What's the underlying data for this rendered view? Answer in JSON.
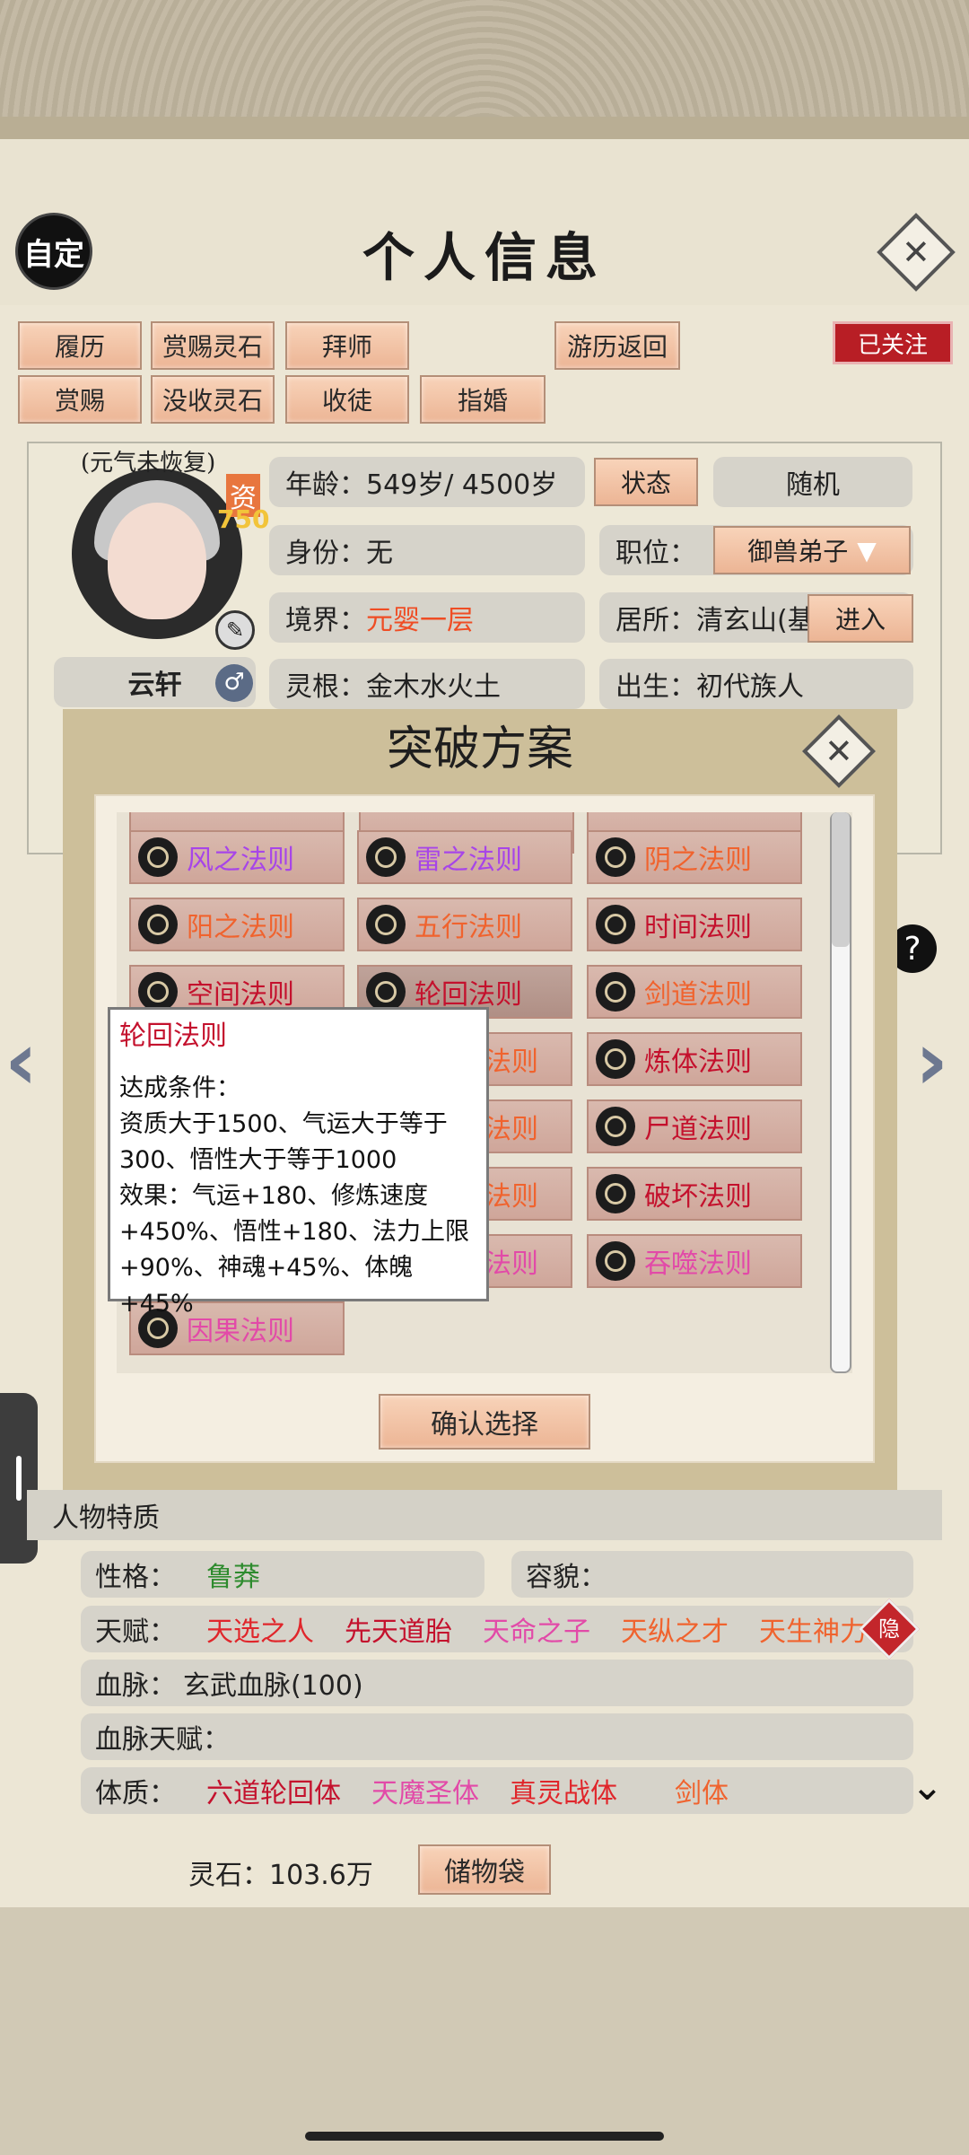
{
  "header": {
    "title": "个人信息",
    "custom_label": "自定",
    "follow_label": "已关注"
  },
  "actions": {
    "row1": [
      "履历",
      "赏赐灵石",
      "拜师"
    ],
    "row2": [
      "赏赐",
      "没收灵石",
      "收徒",
      "指婚"
    ],
    "return_label": "游历返回"
  },
  "profile": {
    "status_note": "(元气未恢复)",
    "aptitude_label": "资",
    "aptitude_value": "750",
    "name": "云轩",
    "age_label": "年龄：",
    "age_value": "549岁/ 4500岁",
    "state_btn": "状态",
    "random_btn": "随机",
    "identity_label": "身份：",
    "identity_value": "无",
    "position_label": "职位：",
    "position_value": "御兽弟子",
    "realm_label": "境界：",
    "realm_value": "元婴一层",
    "residence_label": "居所：",
    "residence_value": "清玄山(基",
    "enter_btn": "进入",
    "root_label": "灵根：",
    "root_value": "金木水火土",
    "birth_label": "出生：",
    "birth_value": "初代族人"
  },
  "dialog": {
    "title": "突破方案",
    "confirm_label": "确认选择",
    "laws": [
      {
        "name": "风之法则",
        "color": "#a745e8"
      },
      {
        "name": "雷之法则",
        "color": "#a745e8"
      },
      {
        "name": "阴之法则",
        "color": "#f0632e"
      },
      {
        "name": "阳之法则",
        "color": "#f0632e"
      },
      {
        "name": "五行法则",
        "color": "#f0632e"
      },
      {
        "name": "时间法则",
        "color": "#c4112d"
      },
      {
        "name": "空间法则",
        "color": "#c4112d"
      },
      {
        "name": "轮回法则",
        "color": "#c4112d"
      },
      {
        "name": "剑道法则",
        "color": "#f0632e"
      },
      {
        "name": "炼体法则",
        "color": "#c4112d"
      },
      {
        "name": "尸道法则",
        "color": "#c4112d"
      },
      {
        "name": "破坏法则",
        "color": "#c4112d"
      },
      {
        "name": "吞噬法则",
        "color": "#e24aa8"
      },
      {
        "name": "因果法则",
        "color": "#e24aa8"
      }
    ],
    "hidden_partial": [
      "法则",
      "法则",
      "法则",
      "法则"
    ]
  },
  "tooltip": {
    "title": "轮回法则",
    "condition_label": "达成条件：",
    "lines": [
      "资质大于1500、气运大于等于",
      "300、悟性大于等于1000",
      "效果：气运+180、修炼速度",
      "+450%、悟性+180、法力上限",
      "+90%、神魂+45%、体魄+45%"
    ]
  },
  "traits": {
    "header": "人物特质",
    "personality_label": "性格：",
    "personality_value": "鲁莽",
    "appearance_label": "容貌：",
    "talent_label": "天赋：",
    "talents": [
      {
        "name": "天选之人",
        "color": "#e0262b"
      },
      {
        "name": "先天道胎",
        "color": "#c4112d"
      },
      {
        "name": "天命之子",
        "color": "#e24aa8"
      },
      {
        "name": "天纵之才",
        "color": "#f0632e"
      },
      {
        "name": "天生神力",
        "color": "#f0632e"
      }
    ],
    "hide_label": "隐",
    "bloodline_label": "血脉：",
    "bloodline_value": "玄武血脉(100)",
    "bloodline_talent_label": "血脉天赋：",
    "physique_label": "体质：",
    "physiques": [
      {
        "name": "六道轮回体",
        "color": "#c4112d"
      },
      {
        "name": "天魔圣体",
        "color": "#e24aa8"
      },
      {
        "name": "真灵战体",
        "color": "#e0262b"
      },
      {
        "name": "剑体",
        "color": "#f0632e"
      }
    ]
  },
  "footer": {
    "spirit_stone": "灵石：103.6万",
    "bag_label": "储物袋"
  }
}
